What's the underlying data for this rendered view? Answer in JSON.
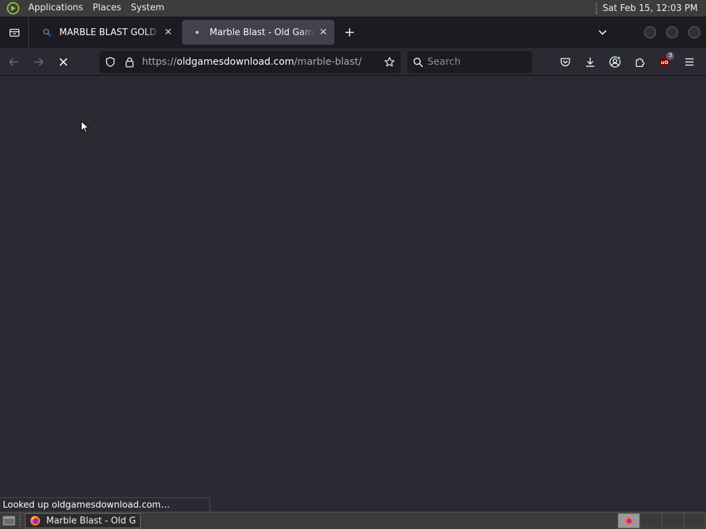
{
  "top_panel": {
    "menus": [
      "Applications",
      "Places",
      "System"
    ],
    "clock": "Sat Feb 15, 12:03 PM"
  },
  "tabs": [
    {
      "title": "MARBLE BLAST GOLD LINUX",
      "icon": "search-favicon-icon",
      "active": false
    },
    {
      "title": "Marble Blast - Old Games Download",
      "icon": "loading-dot-icon",
      "active": true
    }
  ],
  "navbar": {
    "url_scheme": "https://",
    "url_host": "oldgamesdownload.com",
    "url_path": "/marble-blast/",
    "search_placeholder": "Search",
    "extension_badge": "3"
  },
  "status_text": "Looked up oldgamesdownload.com…",
  "taskbar": {
    "window_label": "Marble Blast - Old G…"
  },
  "colors": {
    "content_bg": "#2b2a33",
    "tabstrip_bg": "#1c1b22",
    "panel_bg": "#3c3c3c",
    "ublock_red": "#800000"
  }
}
